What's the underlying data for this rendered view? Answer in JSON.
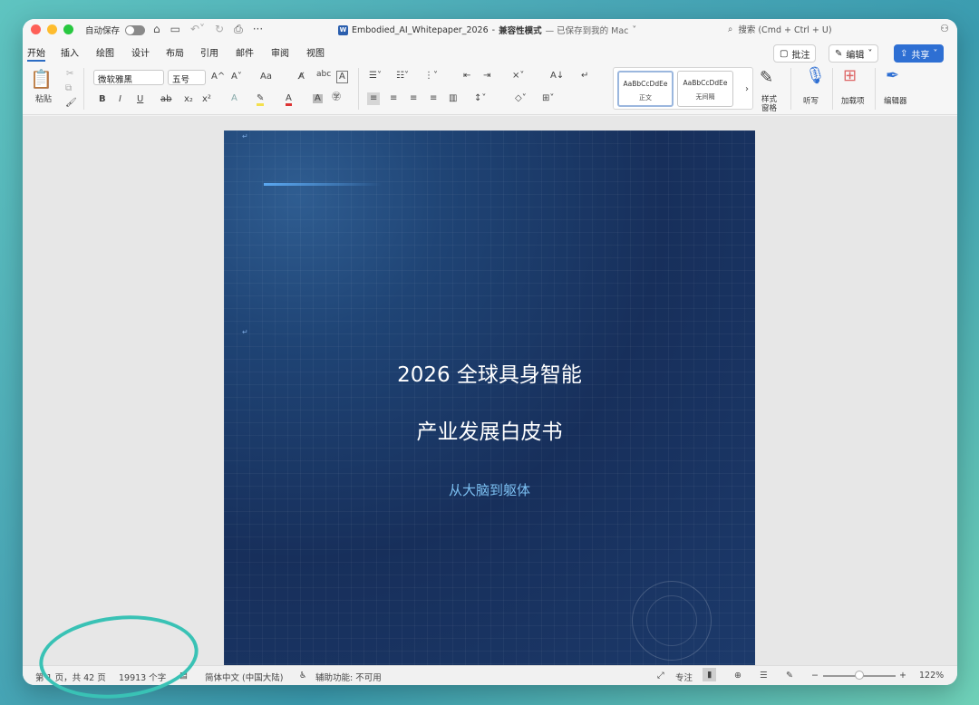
{
  "titlebar": {
    "autosave_label": "自动保存",
    "doc_name": "Embodied_AI_Whitepaper_2026",
    "doc_sep": " - ",
    "mode": "兼容性模式",
    "saved": "— 已保存到我的 Mac",
    "search_placeholder": "搜索 (Cmd + Ctrl + U)"
  },
  "menus": [
    "开始",
    "插入",
    "绘图",
    "设计",
    "布局",
    "引用",
    "邮件",
    "审阅",
    "视图"
  ],
  "buttons": {
    "comment": "批注",
    "edit": "编辑",
    "share": "共享"
  },
  "ribbon": {
    "paste": "粘贴",
    "font": "微软雅黑",
    "size": "五号",
    "style1_sample": "AaBbCcDdEe",
    "style1_name": "正文",
    "style2_sample": "AaBbCcDdEe",
    "style2_name": "无间隔",
    "style_pane": "样式",
    "style_pane2": "窗格",
    "dictate": "听写",
    "addins": "加载项",
    "editor": "编辑器",
    "bold": "B",
    "italic": "I",
    "underline": "U",
    "strike": "ab",
    "sub": "x₂",
    "sup": "x²",
    "grow": "A^",
    "shrink": "A˅",
    "case": "Aa"
  },
  "page": {
    "title1": "2026 全球具身智能",
    "title2": "产业发展白皮书",
    "subtitle": "从大脑到躯体",
    "para_mark": "↵"
  },
  "status": {
    "page": "第 1 页，共 42 页",
    "words": "19913 个字",
    "lang": "简体中文 (中国大陆)",
    "access": "辅助功能: 不可用",
    "focus": "专注",
    "zoom": "122%"
  },
  "colors": {
    "accent": "#2e6fd3",
    "page_bg": "#1b3766",
    "subtitle": "#7cc0f2",
    "annotation_circle": "#39c2b5"
  }
}
